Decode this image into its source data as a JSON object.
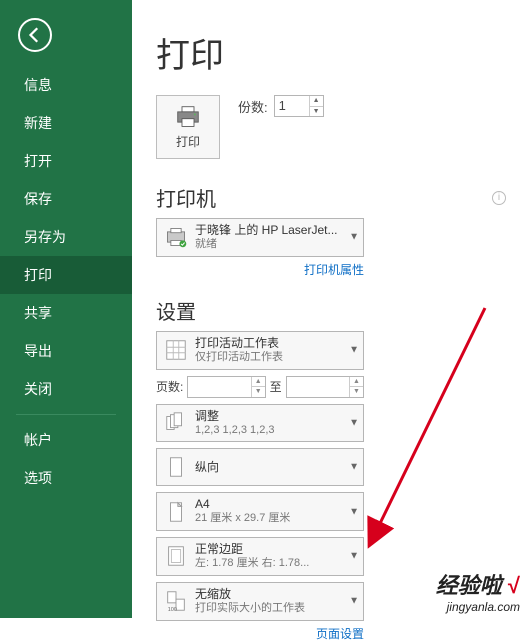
{
  "sidebar": {
    "items": [
      {
        "label": "信息"
      },
      {
        "label": "新建"
      },
      {
        "label": "打开"
      },
      {
        "label": "保存"
      },
      {
        "label": "另存为"
      },
      {
        "label": "打印"
      },
      {
        "label": "共享"
      },
      {
        "label": "导出"
      },
      {
        "label": "关闭"
      }
    ],
    "items2": [
      {
        "label": "帐户"
      },
      {
        "label": "选项"
      }
    ],
    "selected": "打印"
  },
  "main": {
    "title": "打印",
    "print_btn_label": "打印",
    "copies_label": "份数:",
    "copies_value": "1",
    "printer_section": "打印机",
    "printer": {
      "name": "于晓锋 上的 HP LaserJet...",
      "status": "就绪"
    },
    "printer_props_link": "打印机属性",
    "settings_section": "设置",
    "settings": {
      "scope": {
        "line1": "打印活动工作表",
        "line2": "仅打印活动工作表"
      },
      "pages_label": "页数:",
      "pages_to": "至",
      "collate": {
        "line1": "调整",
        "line2": "1,2,3    1,2,3    1,2,3"
      },
      "orientation": {
        "line1": "纵向",
        "line2": ""
      },
      "paper": {
        "line1": "A4",
        "line2": "21 厘米 x 29.7 厘米"
      },
      "margins": {
        "line1": "正常边距",
        "line2": "左: 1.78 厘米  右: 1.78..."
      },
      "scale": {
        "line1": "无缩放",
        "line2": "打印实际大小的工作表"
      }
    },
    "page_setup_link": "页面设置"
  },
  "watermark": {
    "l1_text": "经验啦",
    "l1_check": "√",
    "l2": "jingyanla.com"
  }
}
